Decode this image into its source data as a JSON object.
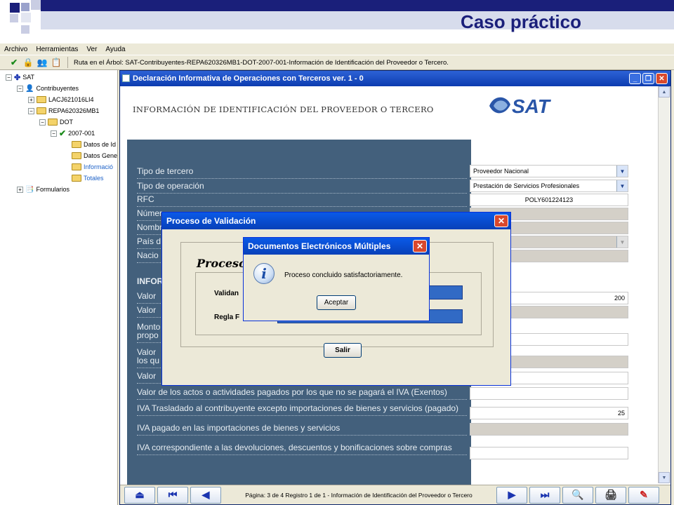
{
  "slide": {
    "title": "Caso práctico"
  },
  "app": {
    "menu": [
      "Archivo",
      "Herramientas",
      "Ver",
      "Ayuda"
    ],
    "path": "Ruta en el Árbol: SAT-Contribuyentes-REPA620326MB1-DOT-2007-001-Información de Identificación del Proveedor o Tercero."
  },
  "tree": {
    "root": "SAT",
    "contribuyentes": "Contribuyentes",
    "c1": "LACJ621016LI4",
    "c2": "REPA620326MB1",
    "dot": "DOT",
    "year": "2007-001",
    "sub1": "Datos de Id",
    "sub2": "Datos Gene",
    "sub3": "Informació",
    "sub4": "Totales",
    "formularios": "Formularios"
  },
  "mdi": {
    "title": "Declaración Informativa de Operaciones con Terceros ver. 1 - 0",
    "form_title": "INFORMACIÓN DE IDENTIFICACIÓN DEL PROVEEDOR O TERCERO",
    "logo": "SAT"
  },
  "fields": {
    "tipo_tercero": "Tipo de tercero",
    "tipo_tercero_val": "Proveedor Nacional",
    "tipo_operacion": "Tipo de operación",
    "tipo_operacion_val": "Prestación de Servicios Profesionales",
    "rfc": "RFC",
    "rfc_val": "POLY601224123",
    "numero": "Númer",
    "nombre": "Nombr",
    "pais": "País d",
    "nacion": "Nacio",
    "info_section": "INFOR",
    "valor1": "Valor",
    "valor1_val": "200",
    "valor2": "Valor",
    "monto_a": "Monto",
    "monto_b": "propo",
    "valor3a": "Valor",
    "valor3b": "los qu",
    "valor4": "Valor",
    "exentos": "Valor de los actos o actividades pagados por los que no se pagará el IVA (Exentos)",
    "iva_trasladado": "IVA Trasladado al contribuyente excepto importaciones de bienes y servicios (pagado)",
    "iva_trasladado_val": "25",
    "iva_importaciones": "IVA pagado en las importaciones de bienes y servicios",
    "iva_devoluciones": "IVA correspondiente a las devoluciones, descuentos y bonificaciones sobre compras"
  },
  "nav": {
    "info": "Página: 3  de  4 Registro  1  de  1  -  Información de Identificación del Proveedor o Tercero"
  },
  "validation_dialog": {
    "title": "Proceso de Validación",
    "heading": "Proceso",
    "label1": "Validan",
    "label2": "Regla F",
    "button": "Salir"
  },
  "message_dialog": {
    "title": "Documentos Electrónicos Múltiples",
    "icon": "i",
    "text": "Proceso concluido satisfactoriamente.",
    "button": "Aceptar"
  },
  "colors": {
    "slide_dark": "#1a1f7a",
    "panel_blue": "#43607c",
    "xp_title": "#0a5ae8"
  }
}
